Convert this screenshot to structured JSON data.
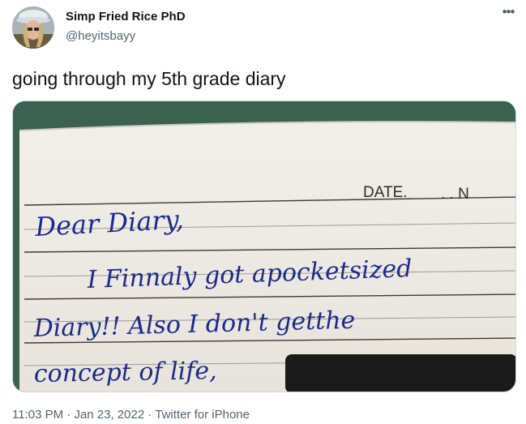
{
  "tweet": {
    "display_name": "Simp Fried Rice PhD",
    "handle": "@heyitsbayy",
    "text": "going through my 5th grade diary",
    "more_icon": "more-dots-icon",
    "timestamp": "11:03 PM",
    "separator": "·",
    "date": "Jan 23, 2022",
    "source": "Twitter for iPhone"
  },
  "media": {
    "date_label": "DATE.",
    "date_dots": ". . N",
    "lines": [
      "Dear Diary,",
      "I Finnaly got apocketsized",
      "Diary!! Also I don't getthe",
      "concept of life,"
    ]
  }
}
